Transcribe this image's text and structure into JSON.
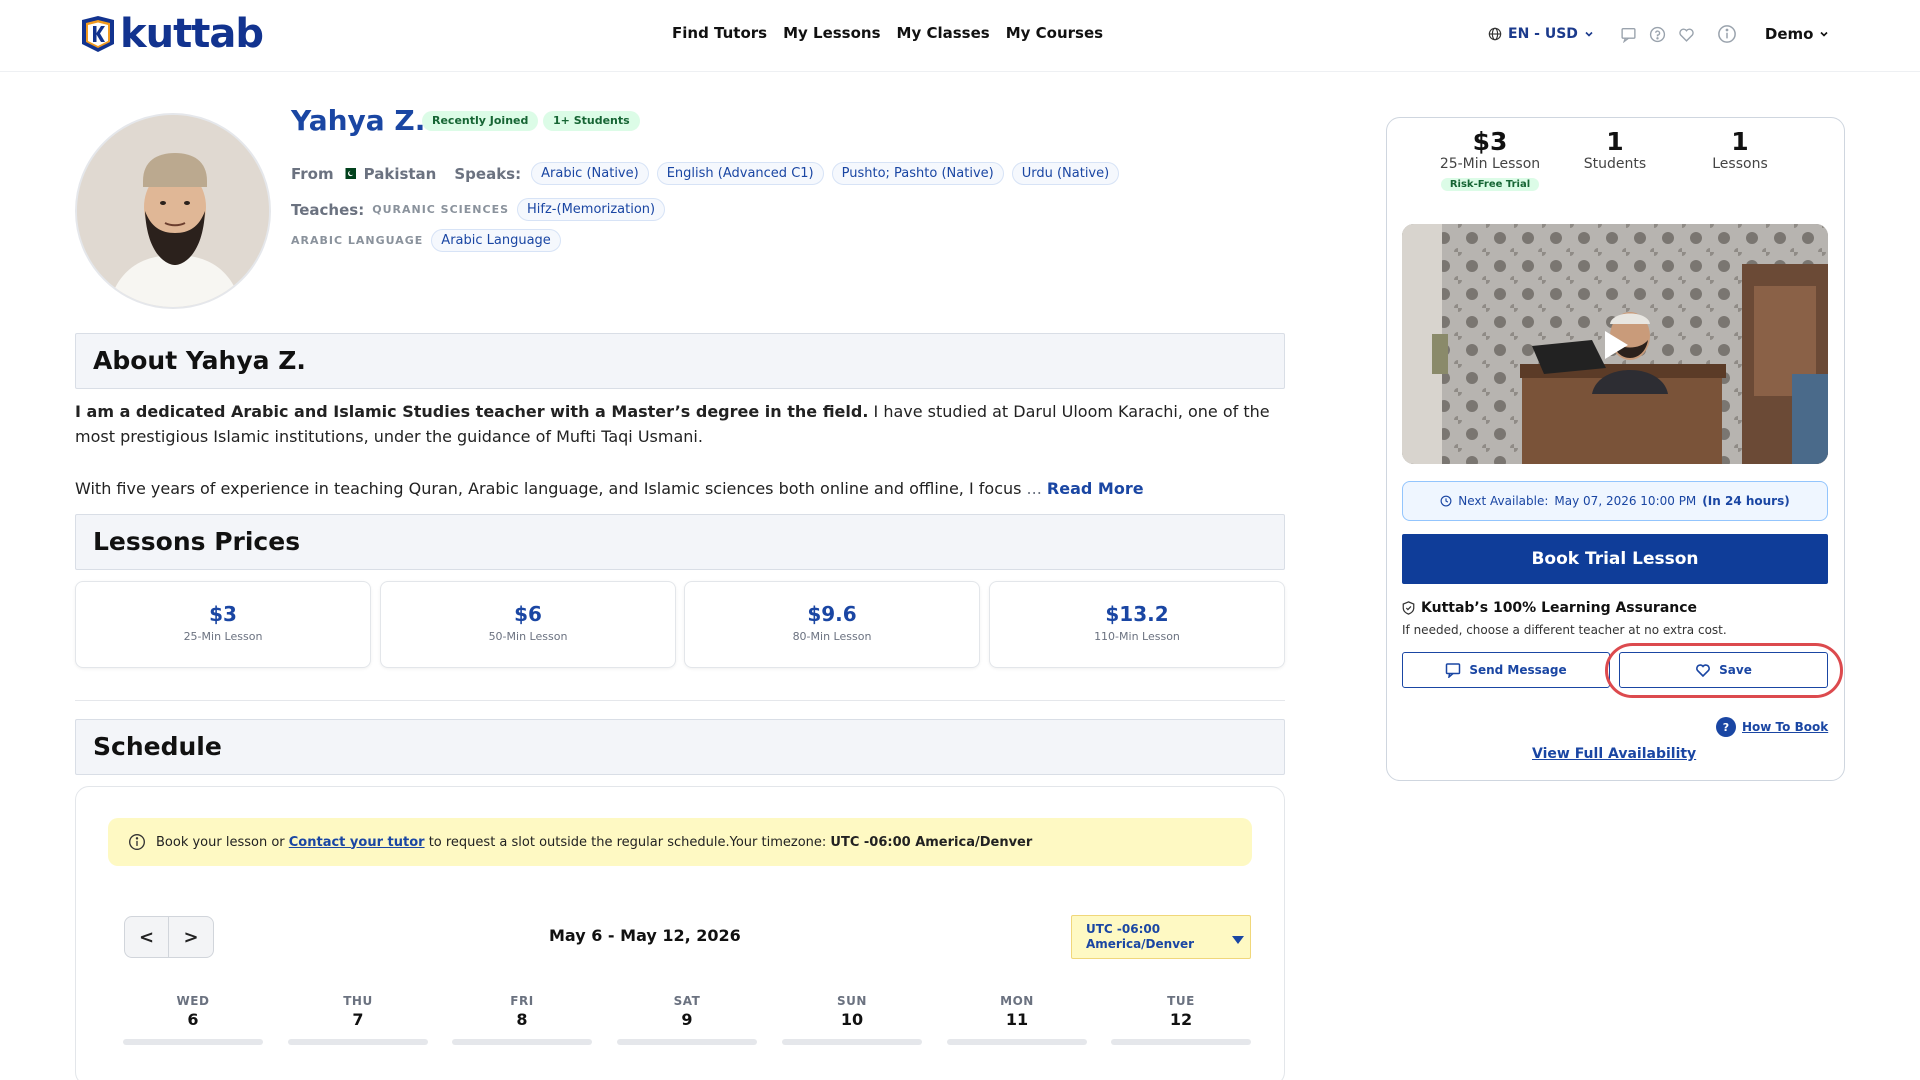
{
  "header": {
    "logo_text": "kuttab",
    "nav": [
      "Find Tutors",
      "My Lessons",
      "My Classes",
      "My Courses"
    ],
    "lang_currency": "EN - USD",
    "user": "Demo"
  },
  "profile": {
    "name": "Yahya Z.",
    "badges": [
      "Recently Joined",
      "1+ Students"
    ],
    "from_label": "From",
    "country": "Pakistan",
    "speaks_label": "Speaks:",
    "languages": [
      "Arabic (Native)",
      "English (Advanced C1)",
      "Pushto; Pashto (Native)",
      "Urdu (Native)"
    ],
    "teaches_label": "Teaches:",
    "subjects": [
      {
        "category": "QURANIC SCIENCES",
        "item": "Hifz-(Memorization)"
      },
      {
        "category": "ARABIC LANGUAGE",
        "item": "Arabic Language"
      }
    ]
  },
  "about": {
    "title": "About Yahya Z.",
    "bold_intro": "I am a dedicated Arabic and Islamic Studies teacher with a Master’s degree in the field.",
    "para1_rest": " I have studied at Darul Uloom Karachi, one of the most prestigious Islamic institutions, under the guidance of Mufti Taqi Usmani.",
    "para2": "With five years of experience in teaching Quran, Arabic language, and Islamic sciences both online and offline, I focus",
    "ellipsis": " ... ",
    "read_more": "Read More"
  },
  "prices": {
    "title": "Lessons Prices",
    "items": [
      {
        "price": "$3",
        "duration": "25-Min Lesson"
      },
      {
        "price": "$6",
        "duration": "50-Min Lesson"
      },
      {
        "price": "$9.6",
        "duration": "80-Min Lesson"
      },
      {
        "price": "$13.2",
        "duration": "110-Min Lesson"
      }
    ]
  },
  "schedule": {
    "title": "Schedule",
    "notice_pre": "Book your lesson or ",
    "notice_link": "Contact your tutor",
    "notice_post": " to request a slot outside the regular schedule.Your timezone: ",
    "notice_tz": "UTC -06:00 America/Denver",
    "prev": "<",
    "next": ">",
    "week_range": "May 6 - May 12, 2026",
    "tz_line1": "UTC -06:00",
    "tz_line2": "America/Denver",
    "days": [
      {
        "name": "WED",
        "num": "6"
      },
      {
        "name": "THU",
        "num": "7"
      },
      {
        "name": "FRI",
        "num": "8"
      },
      {
        "name": "SAT",
        "num": "9"
      },
      {
        "name": "SUN",
        "num": "10"
      },
      {
        "name": "MON",
        "num": "11"
      },
      {
        "name": "TUE",
        "num": "12"
      }
    ]
  },
  "booking": {
    "stats": [
      {
        "value": "$3",
        "label": "25-Min Lesson",
        "badge": "Risk-Free Trial"
      },
      {
        "value": "1",
        "label": "Students"
      },
      {
        "value": "1",
        "label": "Lessons"
      }
    ],
    "next_label": "Next Available:",
    "next_date": "May 07, 2026 10:00 PM",
    "next_in": "(In 24 hours)",
    "book_btn": "Book Trial Lesson",
    "assurance_title": "Kuttab’s 100% Learning Assurance",
    "assurance_sub": "If needed, choose a different teacher at no extra cost.",
    "send_message": "Send Message",
    "save": "Save",
    "how_to_book": "How To Book",
    "view_full": "View Full Availability"
  },
  "colors": {
    "brand": "#12338f",
    "accent": "#1a46a3",
    "primary_button": "#0f3d99",
    "badge_green_bg": "#dcfce7",
    "notice_bg": "#fef9c3",
    "highlight_ring": "#dc4a4e"
  }
}
